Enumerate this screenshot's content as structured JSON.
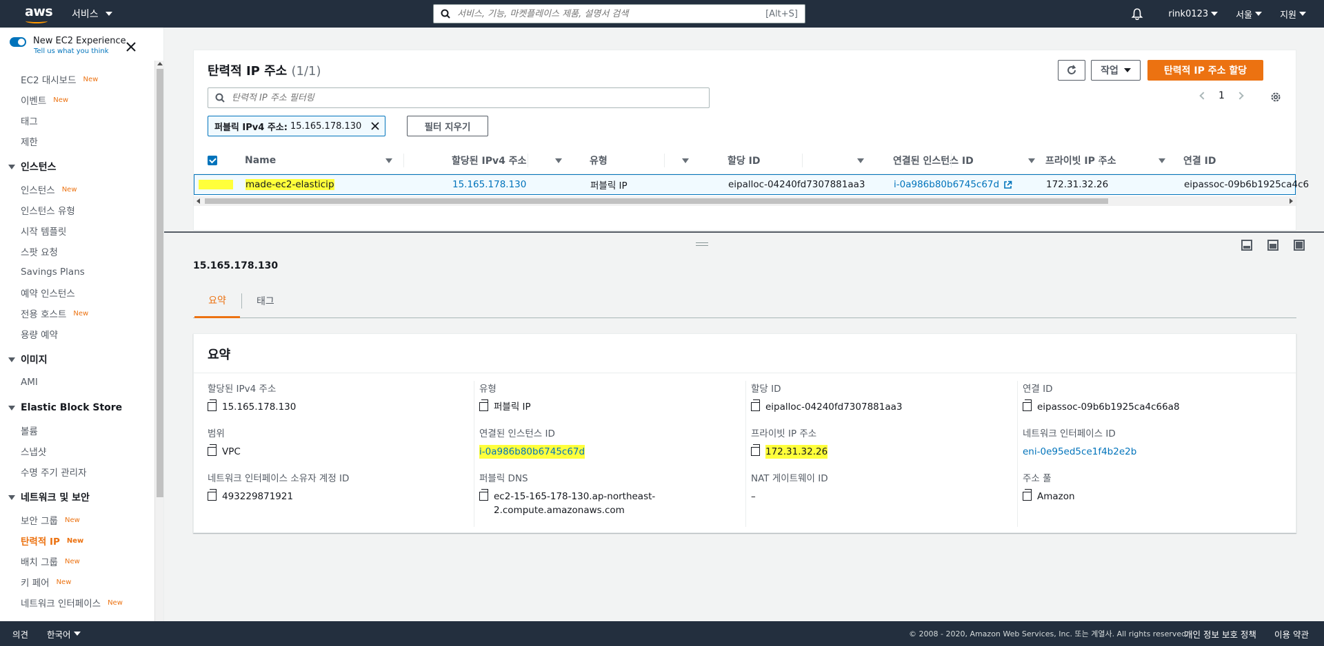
{
  "topnav": {
    "logo": "aws",
    "services_label": "서비스",
    "search_placeholder": "서비스, 기능, 마켓플레이스 제품, 설명서 검색",
    "search_shortcut": "[Alt+S]",
    "user": "rink0123",
    "region": "서울",
    "support": "지원"
  },
  "sidebar": {
    "experience_title": "New EC2 Experience",
    "experience_sub": "Tell us what you think",
    "new_badge": "New",
    "items_top": [
      {
        "label": "EC2 대시보드",
        "new": true
      },
      {
        "label": "이벤트",
        "new": true
      },
      {
        "label": "태그",
        "new": false
      },
      {
        "label": "제한",
        "new": false
      }
    ],
    "group_instances": "인스턴스",
    "items_instances": [
      {
        "label": "인스턴스",
        "new": true
      },
      {
        "label": "인스턴스 유형",
        "new": false
      },
      {
        "label": "시작 템플릿",
        "new": false
      },
      {
        "label": "스팟 요청",
        "new": false
      },
      {
        "label": "Savings Plans",
        "new": false
      },
      {
        "label": "예약 인스턴스",
        "new": false
      },
      {
        "label": "전용 호스트",
        "new": true
      },
      {
        "label": "용량 예약",
        "new": false
      }
    ],
    "group_images": "이미지",
    "items_images": [
      {
        "label": "AMI",
        "new": false
      }
    ],
    "group_ebs": "Elastic Block Store",
    "items_ebs": [
      {
        "label": "볼륨",
        "new": false
      },
      {
        "label": "스냅샷",
        "new": false
      },
      {
        "label": "수명 주기 관리자",
        "new": false
      }
    ],
    "group_network": "네트워크 및 보안",
    "items_network": [
      {
        "label": "보안 그룹",
        "new": true
      },
      {
        "label": "탄력적 IP",
        "new": true,
        "active": true
      },
      {
        "label": "배치 그룹",
        "new": true
      },
      {
        "label": "키 페어",
        "new": true
      },
      {
        "label": "네트워크 인터페이스",
        "new": true
      }
    ]
  },
  "panel": {
    "title": "탄력적 IP 주소",
    "count": "(1/1)",
    "actions_label": "작업",
    "allocate_label": "탄력적 IP 주소 할당",
    "filter_placeholder": "탄력적 IP 주소 필터링",
    "page": "1",
    "token_key": "퍼블릭 IPv4 주소:",
    "token_value": "15.165.178.130",
    "clear_filters": "필터 지우기"
  },
  "table": {
    "headers": [
      "Name",
      "할당된 IPv4 주소",
      "유형",
      "할당 ID",
      "연결된 인스턴스 ID",
      "프라이빗 IP 주소",
      "연결 ID"
    ],
    "row": {
      "name": "made-ec2-elasticip",
      "ipv4": "15.165.178.130",
      "type": "퍼블릭 IP",
      "alloc_id": "eipalloc-04240fd7307881aa3",
      "instance_id": "i-0a986b80b6745c67d",
      "private_ip": "172.31.32.26",
      "assoc_id": "eipassoc-09b6b1925ca4c6"
    }
  },
  "detail": {
    "ip": "15.165.178.130",
    "tab_summary": "요약",
    "tab_tags": "태그",
    "summary_title": "요약",
    "fields": {
      "ipv4_label": "할당된 IPv4 주소",
      "ipv4_value": "15.165.178.130",
      "scope_label": "범위",
      "scope_value": "VPC",
      "owner_label": "네트워크 인터페이스 소유자 계정 ID",
      "owner_value": "493229871921",
      "type_label": "유형",
      "type_value": "퍼블릭 IP",
      "instance_label": "연결된 인스턴스 ID",
      "instance_value": "i-0a986b80b6745c67d",
      "dns_label": "퍼블릭 DNS",
      "dns_value_1": "ec2-15-165-178-130.ap-northeast-",
      "dns_value_2": "2.compute.amazonaws.com",
      "alloc_label": "할당 ID",
      "alloc_value": "eipalloc-04240fd7307881aa3",
      "private_label": "프라이빗 IP 주소",
      "private_value": "172.31.32.26",
      "nat_label": "NAT 게이트웨이 ID",
      "nat_value": "–",
      "assoc_label": "연결 ID",
      "assoc_value": "eipassoc-09b6b1925ca4c66a8",
      "eni_label": "네트워크 인터페이스 ID",
      "eni_value": "eni-0e95ed5ce1f4b2e2b",
      "pool_label": "주소 풀",
      "pool_value": "Amazon"
    }
  },
  "footer": {
    "feedback": "의견",
    "language": "한국어",
    "copyright": "© 2008 - 2020, Amazon Web Services, Inc. 또는 계열사. All rights reserved.",
    "privacy": "개인 정보 보호 정책",
    "terms": "이용 약관"
  },
  "colors": {
    "nav_bg": "#232f3e",
    "accent_orange": "#ec7211",
    "link_blue": "#0073bb",
    "highlight": "#ffff3b"
  }
}
